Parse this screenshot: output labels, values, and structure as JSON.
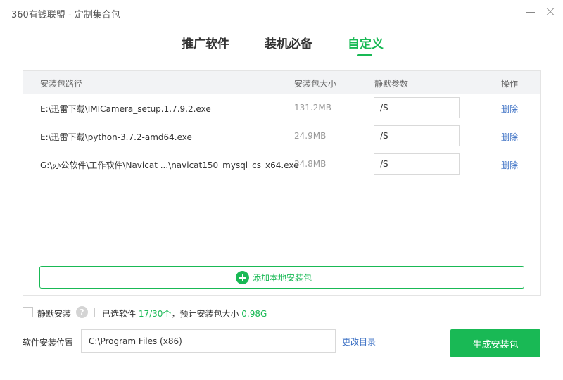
{
  "window": {
    "title": "360有钱联盟 - 定制集合包"
  },
  "tabs": [
    {
      "label": "推广软件",
      "active": false
    },
    {
      "label": "装机必备",
      "active": false
    },
    {
      "label": "自定义",
      "active": true
    }
  ],
  "table": {
    "headers": {
      "path": "安装包路径",
      "size": "安装包大小",
      "param": "静默参数",
      "op": "操作"
    },
    "rows": [
      {
        "path": "E:\\迅雷下载\\IMICamera_setup.1.7.9.2.exe",
        "size": "131.2MB",
        "param": "/S",
        "action": "删除"
      },
      {
        "path": "E:\\迅雷下载\\python-3.7.2-amd64.exe",
        "size": "24.9MB",
        "param": "/S",
        "action": "删除"
      },
      {
        "path": "G:\\办公软件\\工作软件\\Navicat ...\\navicat150_mysql_cs_x64.exe",
        "size": "34.8MB",
        "param": "/S",
        "action": "删除"
      }
    ]
  },
  "add_button": {
    "label": "添加本地安装包"
  },
  "options": {
    "silent_label": "静默安装",
    "silent_checked": false,
    "help_glyph": "?",
    "summary_prefix": "已选软件",
    "selected_count": "17/30个",
    "summary_middle": "，预计安装包大小",
    "total_size": "0.98G"
  },
  "install_location": {
    "label": "软件安装位置",
    "value": "C:\\Program Files (x86)",
    "change_label": "更改目录"
  },
  "generate_button": {
    "label": "生成安装包"
  },
  "colors": {
    "accent": "#19b955",
    "link": "#3a6fc4"
  }
}
